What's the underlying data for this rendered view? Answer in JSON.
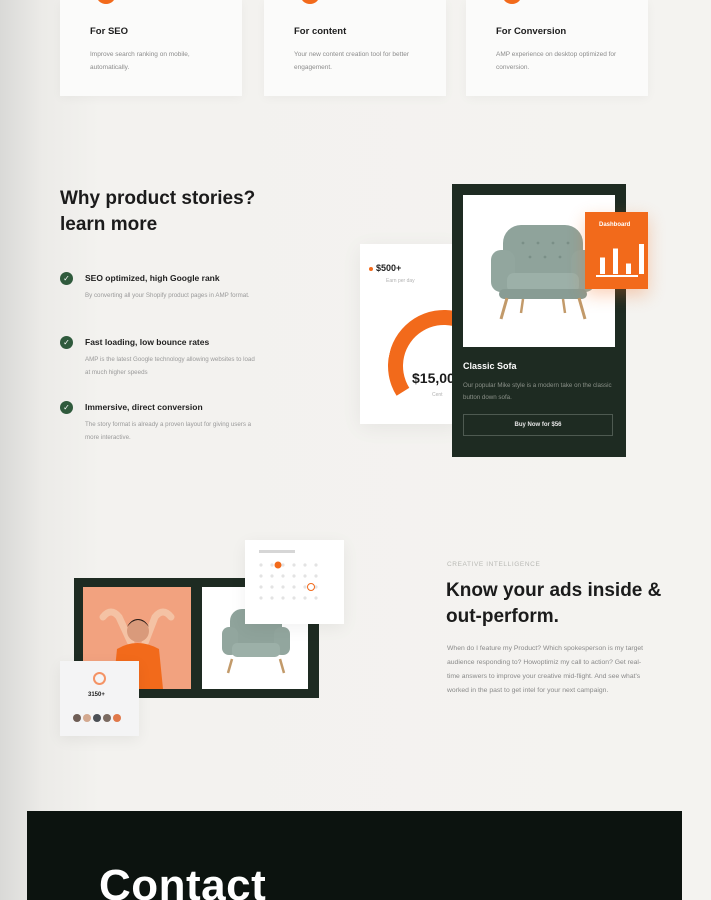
{
  "features": [
    {
      "title": "For SEO",
      "desc": "Improve search ranking on mobile, automatically."
    },
    {
      "title": "For content",
      "desc": "Your new content creation tool for better engagement."
    },
    {
      "title": "For Conversion",
      "desc": "AMP experience on desktop optimized for conversion."
    }
  ],
  "why": {
    "title": "Why product stories? learn more",
    "items": [
      {
        "title": "SEO optimized, high Google rank",
        "desc": "By converting all your Shopify product pages in AMP format."
      },
      {
        "title": "Fast loading, low bounce rates",
        "desc": "AMP is the latest Google technology allowing websites to load at much higher speeds"
      },
      {
        "title": "Immersive, direct conversion",
        "desc": "The story format is already a proven layout for giving users a more interactive."
      }
    ]
  },
  "product_mock": {
    "stat_amount": "$500+",
    "stat_sub": "Earn per day",
    "stat_big": "$15,00",
    "stat_cap": "Cent",
    "product_name": "Classic Sofa",
    "product_desc": "Our popular Mike style is a modern take on the classic button down sofa.",
    "buy_label": "Buy Now for $56",
    "dashboard_label": "Dashboard",
    "bar_levels": [
      0.55,
      0.85,
      0.35,
      1.0
    ]
  },
  "ads": {
    "kicker": "CREATIVE INTELLIGENCE",
    "title": "Know your ads inside & out-perform.",
    "body": "When do I feature my Product? Which spokesperson is my target audience responding to? Howoptimiz my call to action? Get real-time answers to improve your creative mid-flight. And see what's worked in the past to get intel for your next campaign.",
    "mini_value": "3150+"
  },
  "contact": {
    "title": "Contact"
  },
  "colors": {
    "accent": "#f26a1b",
    "dark_green": "#1e2b22",
    "check_green": "#2f5a3c"
  }
}
